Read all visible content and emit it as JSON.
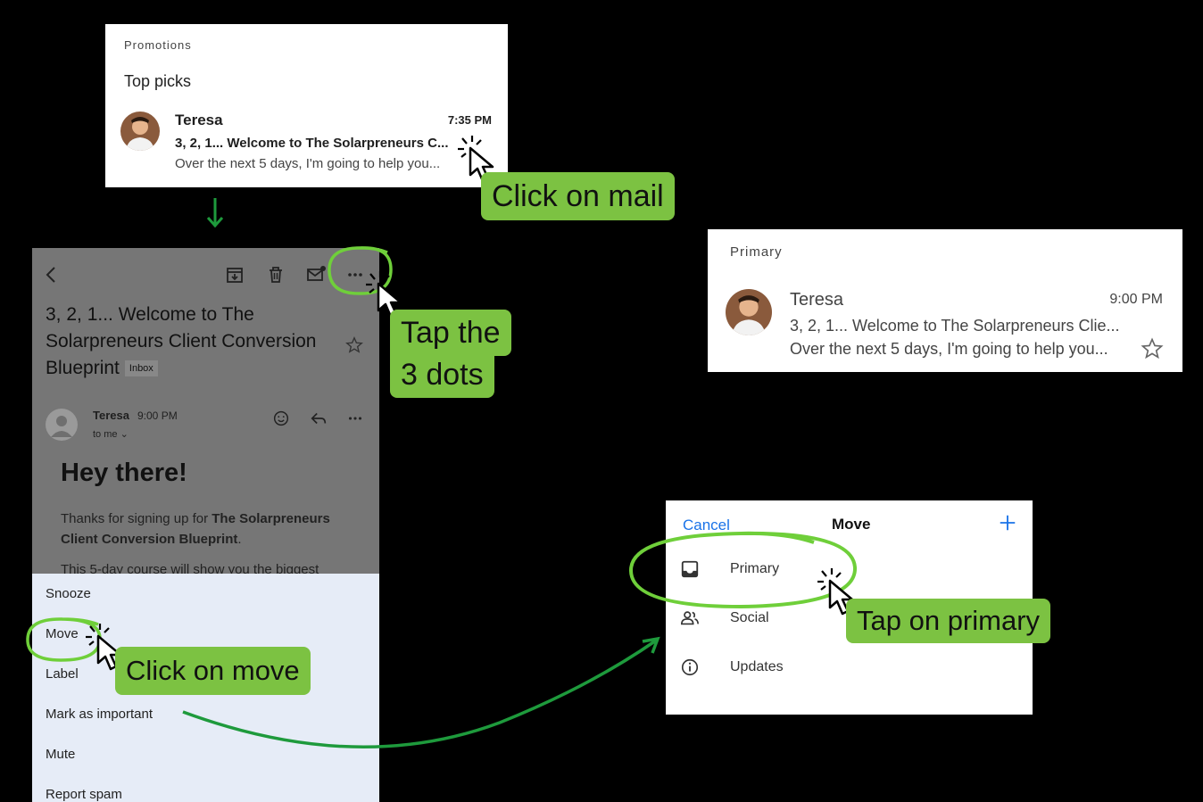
{
  "promo": {
    "section": "Promotions",
    "top_picks": "Top picks",
    "sender": "Teresa",
    "time": "7:35 PM",
    "subject": "3, 2, 1... Welcome to The Solarpreneurs C...",
    "snippet": "Over the next 5 days, I'm going to help you..."
  },
  "email": {
    "title": "3, 2, 1... Welcome to The Solarpreneurs Client Conversion Blueprint",
    "badge": "Inbox",
    "sender": "Teresa",
    "time": "9:00 PM",
    "to": "to me",
    "greeting": "Hey there!",
    "body_prefix": "Thanks for signing up for ",
    "body_bold": "The Solarpreneurs Client Conversion Blueprint",
    "body_suffix": ".",
    "body_cut": "This 5-day course will show you the biggest"
  },
  "menu": {
    "items": [
      "Snooze",
      "Move",
      "Label",
      "Mark as important",
      "Mute",
      "Report spam"
    ]
  },
  "primary": {
    "section": "Primary",
    "sender": "Teresa",
    "time": "9:00 PM",
    "subject": "3, 2, 1... Welcome to The Solarpreneurs Clie...",
    "snippet": "Over the next 5 days, I'm going to help you..."
  },
  "move": {
    "cancel": "Cancel",
    "title": "Move",
    "options": [
      {
        "label": "Primary",
        "icon": "inbox-icon"
      },
      {
        "label": "Social",
        "icon": "people-icon"
      },
      {
        "label": "Updates",
        "icon": "info-icon"
      }
    ]
  },
  "callouts": {
    "click_mail": "Click on mail",
    "tap_dots_1": "Tap the",
    "tap_dots_2": "3 dots",
    "click_move": "Click on move",
    "tap_primary": "Tap on primary"
  },
  "colors": {
    "callout_green": "#7cc242",
    "circle_green": "#6fcf3a",
    "arrow_green": "#1e9a3c",
    "link_blue": "#1a73e8",
    "menu_bg": "#e6ecf7",
    "dimmed_bg": "#767676"
  }
}
